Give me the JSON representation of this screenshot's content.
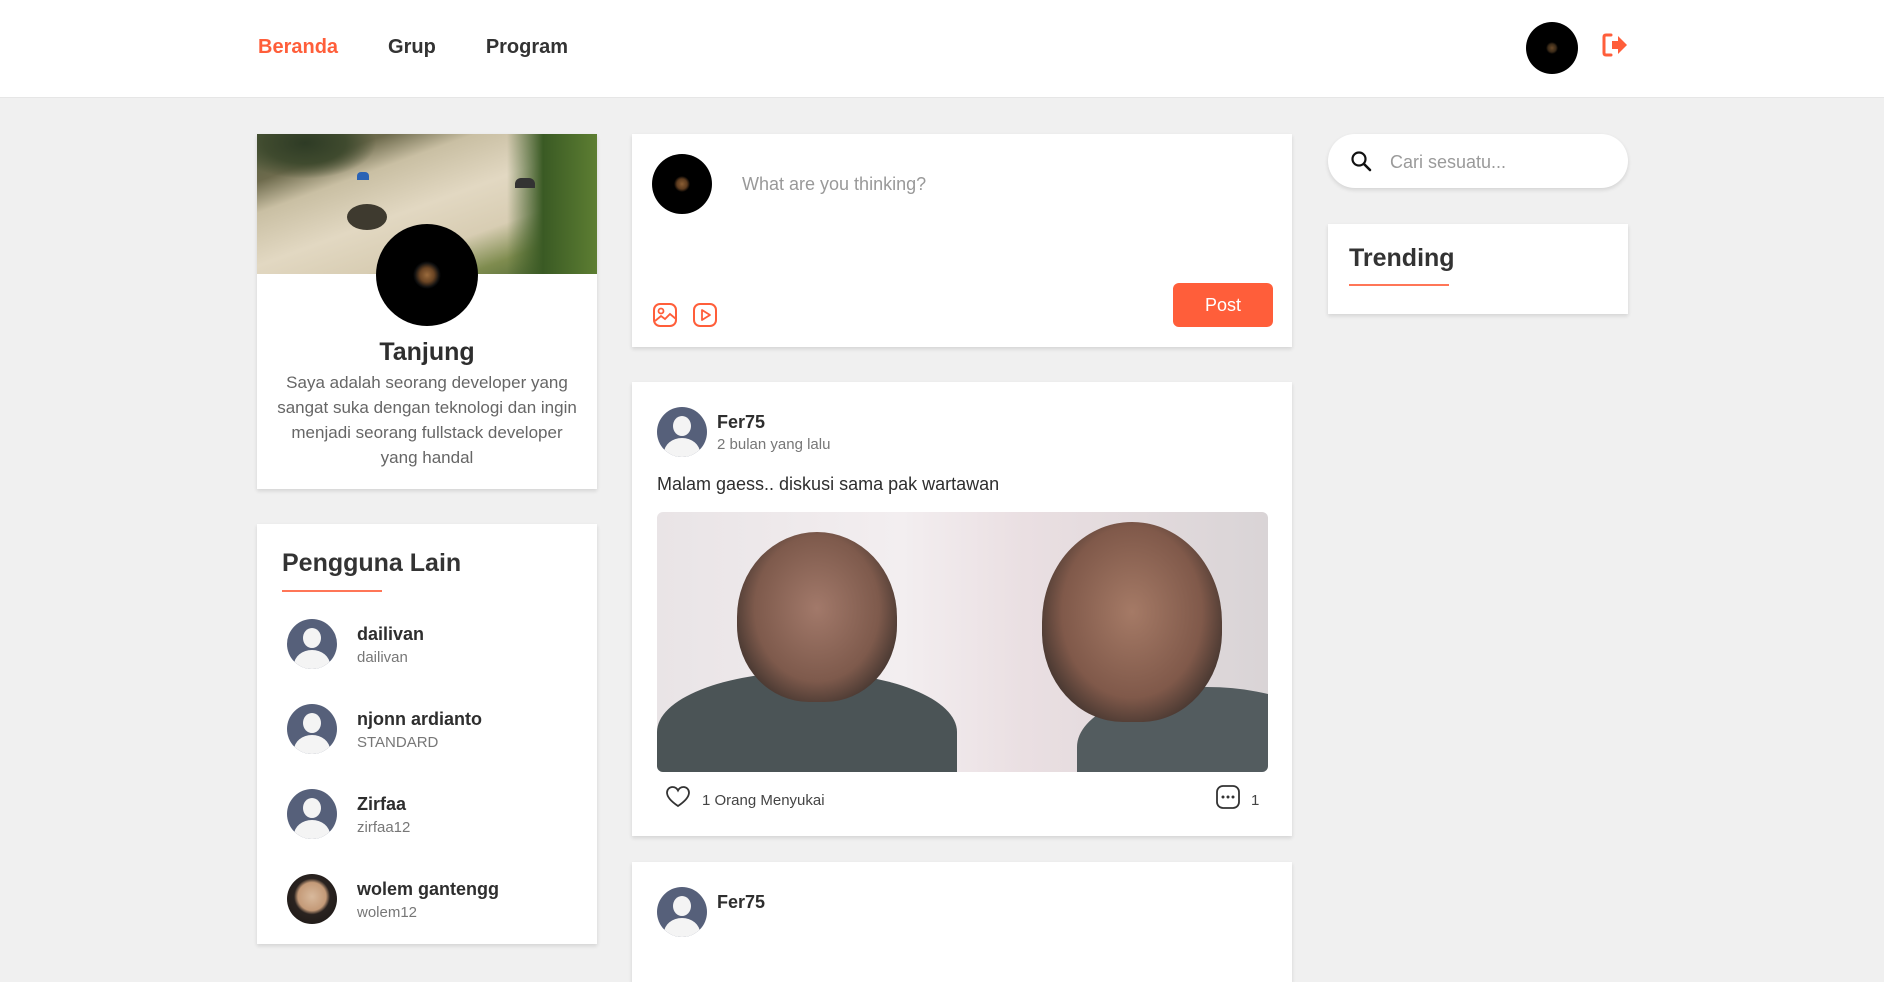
{
  "nav": {
    "items": [
      {
        "label": "Beranda",
        "active": true
      },
      {
        "label": "Grup",
        "active": false
      },
      {
        "label": "Program",
        "active": false
      }
    ],
    "logout_icon": "logout-icon"
  },
  "profile": {
    "name": "Tanjung",
    "bio": "Saya adalah seorang developer yang sangat suka dengan teknologi dan ingin menjadi seorang fullstack developer yang handal"
  },
  "other_users": {
    "title": "Pengguna Lain",
    "items": [
      {
        "name": "dailivan",
        "handle": "dailivan"
      },
      {
        "name": "njonn ardianto",
        "handle": "STANDARD"
      },
      {
        "name": "Zirfaa",
        "handle": "zirfaa12"
      },
      {
        "name": "wolem gantengg",
        "handle": "wolem12"
      }
    ]
  },
  "composer": {
    "placeholder": "What are you thinking?",
    "post_label": "Post",
    "icons": [
      "image-icon",
      "video-icon"
    ]
  },
  "posts": [
    {
      "author": "Fer75",
      "time": "2 bulan yang lalu",
      "text": "Malam gaess.. diskusi sama pak wartawan",
      "likes": "1 Orang Menyukai",
      "comments": "1"
    },
    {
      "author": "Fer75"
    }
  ],
  "search": {
    "placeholder": "Cari sesuatu..."
  },
  "trending": {
    "title": "Trending"
  },
  "colors": {
    "accent": "#ff5e3a",
    "background": "#f0f0f0"
  }
}
